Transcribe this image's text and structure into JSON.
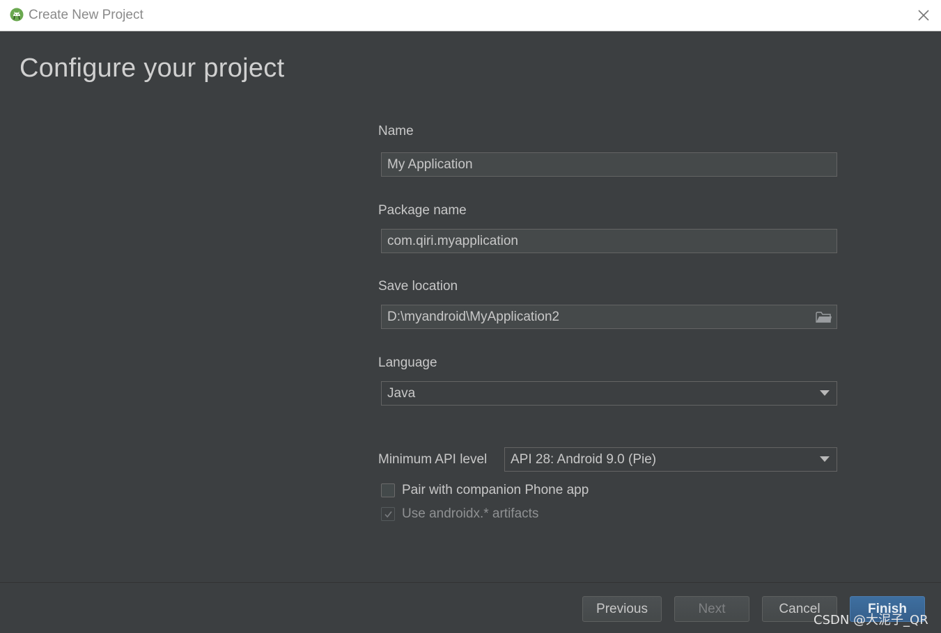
{
  "window": {
    "title": "Create New Project"
  },
  "page": {
    "heading": "Configure your project"
  },
  "form": {
    "name_label": "Name",
    "name_value": "My Application",
    "package_label": "Package name",
    "package_value": "com.qiri.myapplication",
    "save_label": "Save location",
    "save_value": "D:\\myandroid\\MyApplication2",
    "language_label": "Language",
    "language_value": "Java",
    "min_api_label": "Minimum API level",
    "min_api_value": "API 28: Android 9.0 (Pie)",
    "pair_label": "Pair with companion Phone app",
    "pair_checked": false,
    "androidx_label": "Use androidx.* artifacts",
    "androidx_checked": true
  },
  "buttons": {
    "previous": "Previous",
    "next": "Next",
    "cancel": "Cancel",
    "finish": "Finish"
  },
  "watermark": "CSDN @大泥子_QR",
  "icons": {
    "app": "android-studio-icon",
    "close": "close-icon",
    "folder": "folder-icon",
    "dropdown": "chevron-down-icon",
    "check": "checkmark-icon"
  },
  "colors": {
    "background": "#3c3f41",
    "field": "#45494a",
    "text": "#c8c8c8",
    "primary": "#365f8b"
  }
}
